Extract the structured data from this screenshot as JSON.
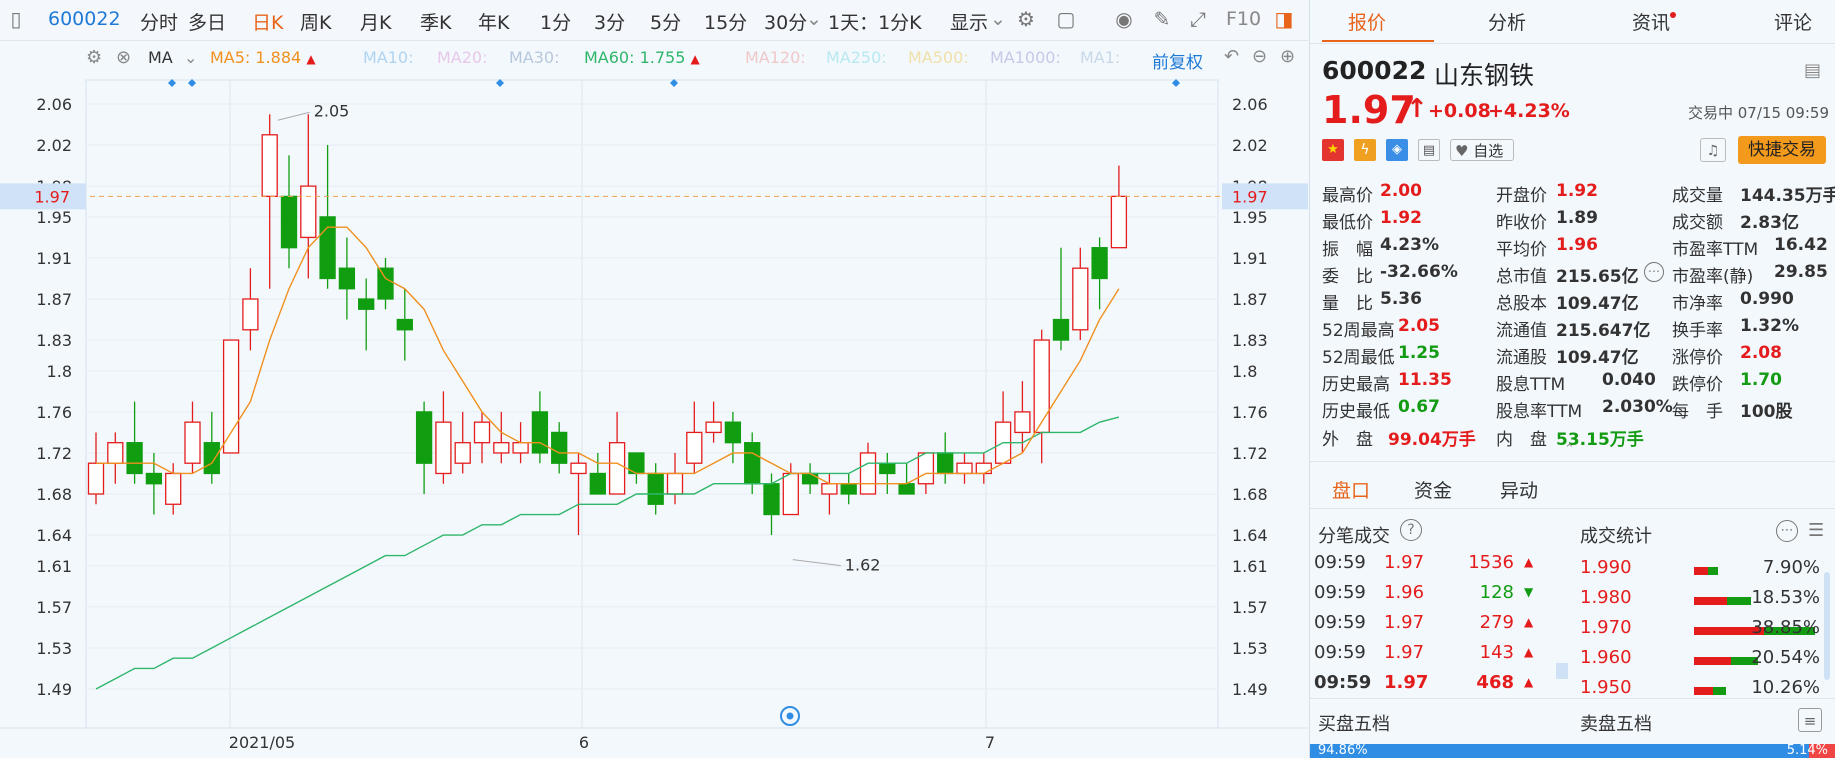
{
  "toolbar": {
    "code": "600022",
    "periods": [
      "分时",
      "多日",
      "日K",
      "周K",
      "月K",
      "季K",
      "年K",
      "1分",
      "3分",
      "5分",
      "15分",
      "30分"
    ],
    "active_period": "日K",
    "range_select": "1天：1分K",
    "display": "显示",
    "f10": "F10"
  },
  "indicator": {
    "name": "MA",
    "ma5": "MA5: 1.884",
    "ma10": "MA10:",
    "ma20": "MA20:",
    "ma30": "MA30:",
    "ma60": "MA60: 1.755",
    "ma120": "MA120:",
    "ma250": "MA250:",
    "ma500": "MA500:",
    "ma1000": "MA1000:",
    "ma1": "MA1:",
    "fq": "前复权"
  },
  "colors": {
    "up": "#e41c1c",
    "down": "#109e10",
    "ma5": "#f0901e",
    "ma60": "#2fb66a",
    "accent": "#e8641b",
    "blue": "#1f7ad6"
  },
  "chart_data": {
    "type": "candlestick",
    "x_labels": [
      "2021/05",
      "6",
      "7"
    ],
    "y_ticks": [
      2.06,
      2.02,
      1.98,
      1.95,
      1.91,
      1.87,
      1.83,
      1.8,
      1.76,
      1.72,
      1.68,
      1.64,
      1.61,
      1.57,
      1.53,
      1.49
    ],
    "ylim": [
      1.47,
      2.08
    ],
    "current_price": "1.97",
    "high_label": "2.05",
    "low_label": "1.62",
    "candles": [
      [
        1.68,
        1.71,
        1.67,
        1.74
      ],
      [
        1.71,
        1.73,
        1.69,
        1.74
      ],
      [
        1.73,
        1.7,
        1.69,
        1.77
      ],
      [
        1.7,
        1.69,
        1.66,
        1.72
      ],
      [
        1.67,
        1.7,
        1.66,
        1.71
      ],
      [
        1.71,
        1.75,
        1.7,
        1.77
      ],
      [
        1.73,
        1.7,
        1.69,
        1.76
      ],
      [
        1.72,
        1.83,
        1.72,
        1.83
      ],
      [
        1.84,
        1.87,
        1.82,
        1.9
      ],
      [
        1.97,
        2.03,
        1.88,
        2.05
      ],
      [
        1.97,
        1.92,
        1.9,
        2.01
      ],
      [
        1.93,
        1.98,
        1.89,
        2.05
      ],
      [
        1.95,
        1.89,
        1.88,
        2.02
      ],
      [
        1.9,
        1.88,
        1.85,
        1.93
      ],
      [
        1.87,
        1.86,
        1.82,
        1.89
      ],
      [
        1.9,
        1.87,
        1.86,
        1.91
      ],
      [
        1.85,
        1.84,
        1.81,
        1.88
      ],
      [
        1.76,
        1.71,
        1.68,
        1.77
      ],
      [
        1.7,
        1.75,
        1.69,
        1.78
      ],
      [
        1.71,
        1.73,
        1.7,
        1.76
      ],
      [
        1.73,
        1.75,
        1.71,
        1.76
      ],
      [
        1.72,
        1.73,
        1.71,
        1.76
      ],
      [
        1.72,
        1.73,
        1.71,
        1.75
      ],
      [
        1.76,
        1.72,
        1.71,
        1.78
      ],
      [
        1.74,
        1.71,
        1.7,
        1.75
      ],
      [
        1.7,
        1.71,
        1.64,
        1.72
      ],
      [
        1.7,
        1.68,
        1.68,
        1.72
      ],
      [
        1.68,
        1.73,
        1.68,
        1.76
      ],
      [
        1.72,
        1.7,
        1.69,
        1.72
      ],
      [
        1.7,
        1.67,
        1.66,
        1.71
      ],
      [
        1.68,
        1.7,
        1.67,
        1.72
      ],
      [
        1.71,
        1.74,
        1.7,
        1.77
      ],
      [
        1.74,
        1.75,
        1.73,
        1.77
      ],
      [
        1.75,
        1.73,
        1.71,
        1.76
      ],
      [
        1.73,
        1.69,
        1.68,
        1.74
      ],
      [
        1.69,
        1.66,
        1.64,
        1.7
      ],
      [
        1.66,
        1.7,
        1.66,
        1.71
      ],
      [
        1.7,
        1.69,
        1.68,
        1.71
      ],
      [
        1.68,
        1.69,
        1.66,
        1.7
      ],
      [
        1.69,
        1.68,
        1.67,
        1.7
      ],
      [
        1.68,
        1.72,
        1.68,
        1.73
      ],
      [
        1.71,
        1.7,
        1.68,
        1.72
      ],
      [
        1.69,
        1.68,
        1.68,
        1.71
      ],
      [
        1.69,
        1.72,
        1.68,
        1.72
      ],
      [
        1.72,
        1.7,
        1.69,
        1.74
      ],
      [
        1.7,
        1.71,
        1.69,
        1.72
      ],
      [
        1.7,
        1.71,
        1.69,
        1.72
      ],
      [
        1.71,
        1.75,
        1.71,
        1.78
      ],
      [
        1.74,
        1.76,
        1.72,
        1.79
      ],
      [
        1.74,
        1.83,
        1.71,
        1.84
      ],
      [
        1.85,
        1.83,
        1.82,
        1.92
      ],
      [
        1.84,
        1.9,
        1.83,
        1.92
      ],
      [
        1.92,
        1.89,
        1.86,
        1.93
      ],
      [
        1.92,
        1.97,
        1.92,
        2.0
      ]
    ],
    "ma5": [
      1.71,
      1.71,
      1.71,
      1.71,
      1.7,
      1.7,
      1.71,
      1.74,
      1.77,
      1.83,
      1.88,
      1.92,
      1.94,
      1.94,
      1.92,
      1.89,
      1.88,
      1.86,
      1.82,
      1.79,
      1.76,
      1.74,
      1.73,
      1.73,
      1.72,
      1.72,
      1.71,
      1.71,
      1.7,
      1.7,
      1.7,
      1.7,
      1.71,
      1.72,
      1.72,
      1.71,
      1.7,
      1.7,
      1.69,
      1.69,
      1.69,
      1.69,
      1.69,
      1.7,
      1.7,
      1.7,
      1.7,
      1.71,
      1.72,
      1.75,
      1.78,
      1.81,
      1.85,
      1.88
    ],
    "ma60": [
      1.49,
      1.5,
      1.51,
      1.51,
      1.52,
      1.52,
      1.53,
      1.54,
      1.55,
      1.56,
      1.57,
      1.58,
      1.59,
      1.6,
      1.61,
      1.62,
      1.62,
      1.63,
      1.64,
      1.64,
      1.65,
      1.65,
      1.66,
      1.66,
      1.66,
      1.67,
      1.67,
      1.67,
      1.68,
      1.68,
      1.68,
      1.68,
      1.69,
      1.69,
      1.69,
      1.69,
      1.7,
      1.7,
      1.7,
      1.7,
      1.71,
      1.71,
      1.71,
      1.72,
      1.72,
      1.72,
      1.72,
      1.73,
      1.73,
      1.74,
      1.74,
      1.74,
      1.75,
      1.755
    ]
  },
  "quote": {
    "tabs": [
      "报价",
      "分析",
      "资讯",
      "评论"
    ],
    "code": "600022",
    "name": "山东钢铁",
    "price": "1.97",
    "change": "+0.08",
    "change_pct": "+4.23%",
    "status": "交易中 07/15 09:59",
    "watch": "自选",
    "quick_trade": "快捷交易",
    "fields": [
      [
        "最高价",
        "2.00",
        "red"
      ],
      [
        "开盘价",
        "1.92",
        "red"
      ],
      [
        "成交量",
        "144.35万手",
        "dark"
      ],
      [
        "最低价",
        "1.92",
        "red"
      ],
      [
        "昨收价",
        "1.89",
        "dark"
      ],
      [
        "成交额",
        "2.83亿",
        "dark"
      ],
      [
        "振　幅",
        "4.23%",
        "dark"
      ],
      [
        "平均价",
        "1.96",
        "red"
      ],
      [
        "市盈率TTM",
        "16.42",
        "dark"
      ],
      [
        "委　比",
        "-32.66%",
        "dark"
      ],
      [
        "总市值",
        "215.65亿",
        "dark"
      ],
      [
        "市盈率(静)",
        "29.85",
        "dark"
      ],
      [
        "量　比",
        "5.36",
        "dark"
      ],
      [
        "总股本",
        "109.47亿",
        "dark"
      ],
      [
        "市净率",
        "0.990",
        "dark"
      ],
      [
        "52周最高",
        "2.05",
        "red"
      ],
      [
        "流通值",
        "215.647亿",
        "dark"
      ],
      [
        "换手率",
        "1.32%",
        "dark"
      ],
      [
        "52周最低",
        "1.25",
        "green"
      ],
      [
        "流通股",
        "109.47亿",
        "dark"
      ],
      [
        "涨停价",
        "2.08",
        "red"
      ],
      [
        "历史最高",
        "11.35",
        "red"
      ],
      [
        "股息TTM",
        "0.040",
        "dark"
      ],
      [
        "跌停价",
        "1.70",
        "green"
      ],
      [
        "历史最低",
        "0.67",
        "green"
      ],
      [
        "股息率TTM",
        "2.030%",
        "dark"
      ],
      [
        "每　手",
        "100股",
        "dark"
      ]
    ],
    "outer_label": "外　盘",
    "outer_value": "99.04万手",
    "inner_label": "内　盘",
    "inner_value": "53.15万手"
  },
  "subtabs": [
    "盘口",
    "资金",
    "异动"
  ],
  "ticks": {
    "title": "分笔成交",
    "rows": [
      [
        "09:59",
        "1.97",
        "1536",
        "up"
      ],
      [
        "09:59",
        "1.96",
        "128",
        "down"
      ],
      [
        "09:59",
        "1.97",
        "279",
        "up"
      ],
      [
        "09:59",
        "1.97",
        "143",
        "up"
      ],
      [
        "09:59",
        "1.97",
        "468",
        "up"
      ]
    ]
  },
  "stats": {
    "title": "成交统计",
    "rows": [
      [
        "1.990",
        "7.90%",
        0.079
      ],
      [
        "1.980",
        "18.53%",
        0.185
      ],
      [
        "1.970",
        "38.85%",
        0.389
      ],
      [
        "1.960",
        "20.54%",
        0.205
      ],
      [
        "1.950",
        "10.26%",
        0.103
      ]
    ]
  },
  "orderbook": {
    "buy_title": "买盘五档",
    "sell_title": "卖盘五档",
    "buy_pct": "94.86%",
    "sell_pct": "5.14%",
    "buy_ratio": 0.9486
  }
}
